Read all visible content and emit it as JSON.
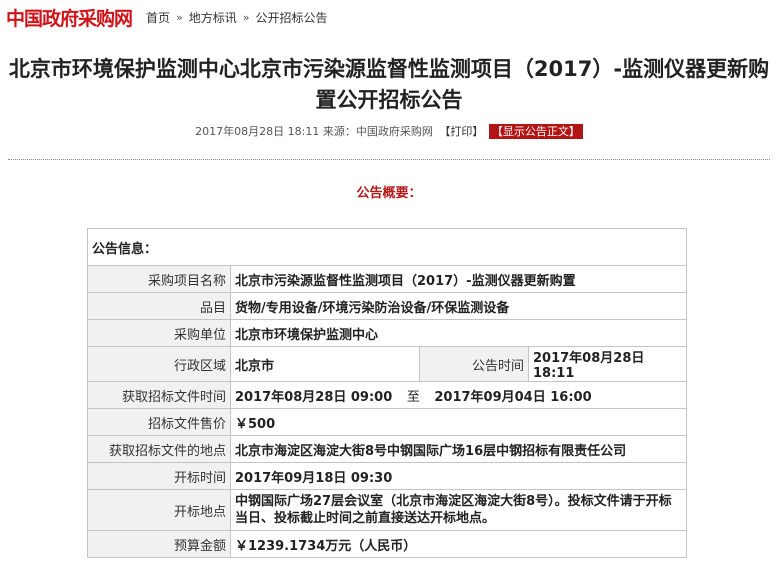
{
  "header": {
    "logo": "中国政府采购网",
    "breadcrumb": [
      "首页",
      "地方标讯",
      "公开招标公告"
    ],
    "separator": "»"
  },
  "article": {
    "title": "北京市环境保护监测中心北京市污染源监督性监测项目（2017）-监测仪器更新购置公开招标公告",
    "date": "2017年08月28日 18:11",
    "source_label": "来源：中国政府采购网",
    "print_label": "【打印】",
    "show_label": "【显示公告正文】"
  },
  "summary_title": "公告概要：",
  "info": {
    "section_title": "公告信息：",
    "rows": {
      "project_name": {
        "label": "采购项目名称",
        "value": "北京市污染源监督性监测项目（2017）-监测仪器更新购置"
      },
      "category": {
        "label": "品目",
        "value": "货物/专用设备/环境污染防治设备/环保监测设备"
      },
      "purchaser": {
        "label": "采购单位",
        "value": "北京市环境保护监测中心"
      },
      "region": {
        "label": "行政区域",
        "value": "北京市",
        "label2": "公告时间",
        "value2": "2017年08月28日 18:11"
      },
      "obtain_time": {
        "label": "获取招标文件时间",
        "from": "2017年08月28日 09:00",
        "to_label": "至",
        "to": "2017年09月04日 16:00"
      },
      "price": {
        "label": "招标文件售价",
        "value": "￥500"
      },
      "obtain_place": {
        "label": "获取招标文件的地点",
        "value": "北京市海淀区海淀大街8号中钢国际广场16层中钢招标有限责任公司"
      },
      "open_time": {
        "label": "开标时间",
        "value": "2017年09月18日 09:30"
      },
      "open_place": {
        "label": "开标地点",
        "value": "中钢国际广场27层会议室（北京市海淀区海淀大街8号）。投标文件请于开标当日、投标截止时间之前直接送达开标地点。"
      },
      "budget": {
        "label": "预算金额",
        "value": "￥1239.1734万元（人民币）"
      }
    }
  }
}
